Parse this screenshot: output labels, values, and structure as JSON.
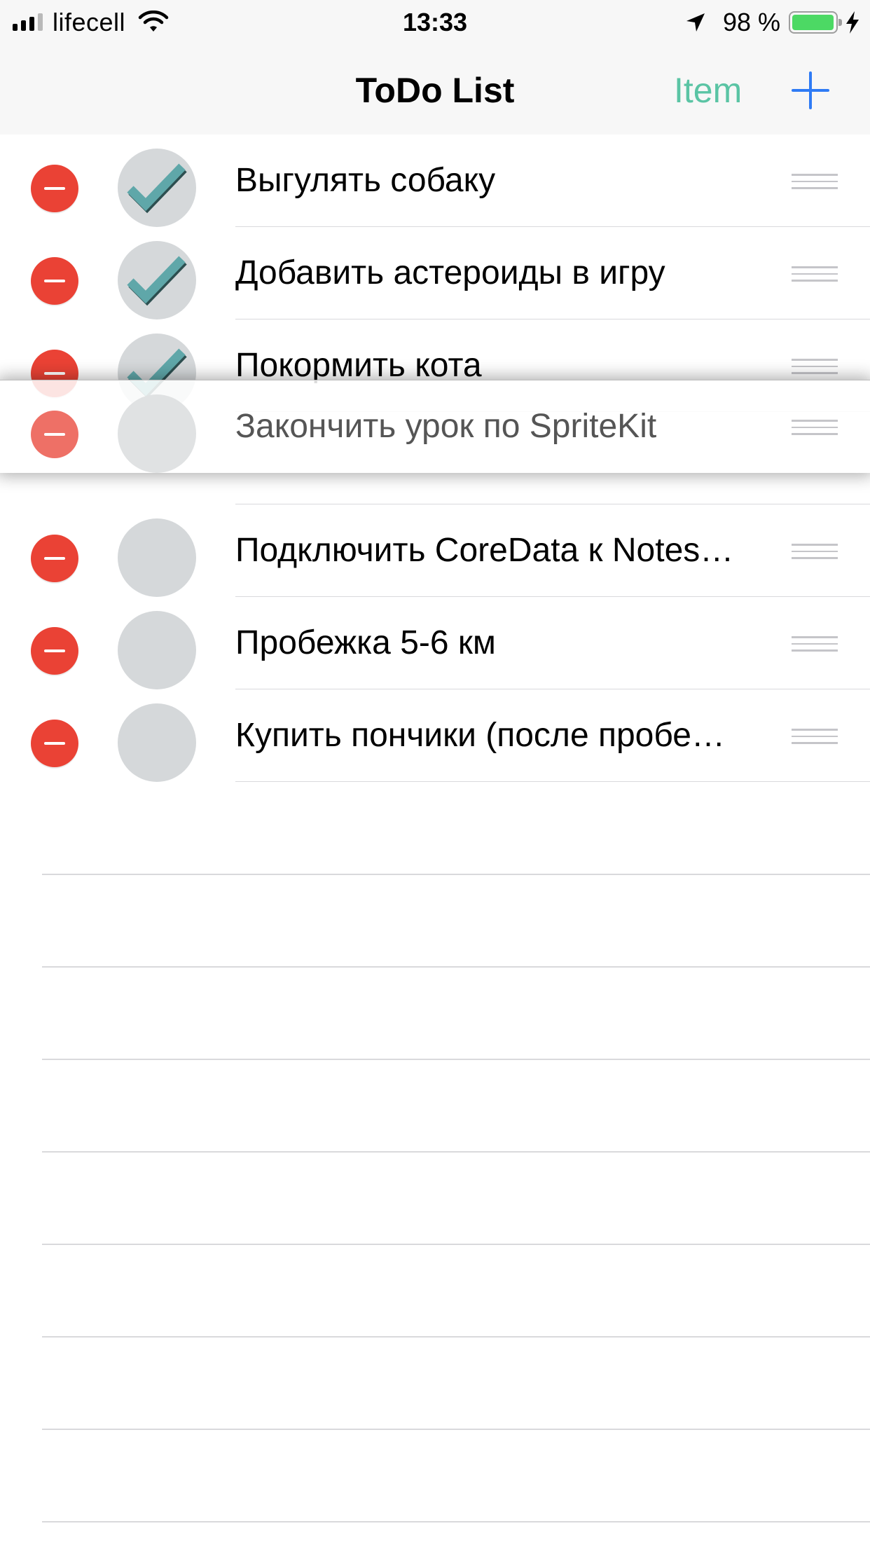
{
  "status_bar": {
    "carrier": "lifecell",
    "time": "13:33",
    "battery_percent": "98 %",
    "battery_level": 0.98,
    "icons": [
      "signal-icon",
      "wifi-icon",
      "location-arrow-icon",
      "battery-icon",
      "charging-bolt-icon"
    ]
  },
  "nav": {
    "title": "ToDo List",
    "item_button": "Item",
    "add_icon": "plus-icon"
  },
  "colors": {
    "delete": "#ea4235",
    "check": "#5fa7a9",
    "circle": "#d5d8da",
    "item_button": "#5ac4a4",
    "add_button": "#2f7bf5"
  },
  "tasks": [
    {
      "title": "Выгулять собаку",
      "done": true
    },
    {
      "title": "Добавить астероиды в игру",
      "done": true
    },
    {
      "title": "Покормить кота",
      "done": true
    },
    {
      "title": "Подключить CoreData к Notes…",
      "done": false
    },
    {
      "title": "Пробежка 5-6 км",
      "done": false
    },
    {
      "title": "Купить пончики (после пробе…",
      "done": false
    }
  ],
  "dragged_task": {
    "title": "Закончить урок по SpriteKit",
    "done": false
  }
}
